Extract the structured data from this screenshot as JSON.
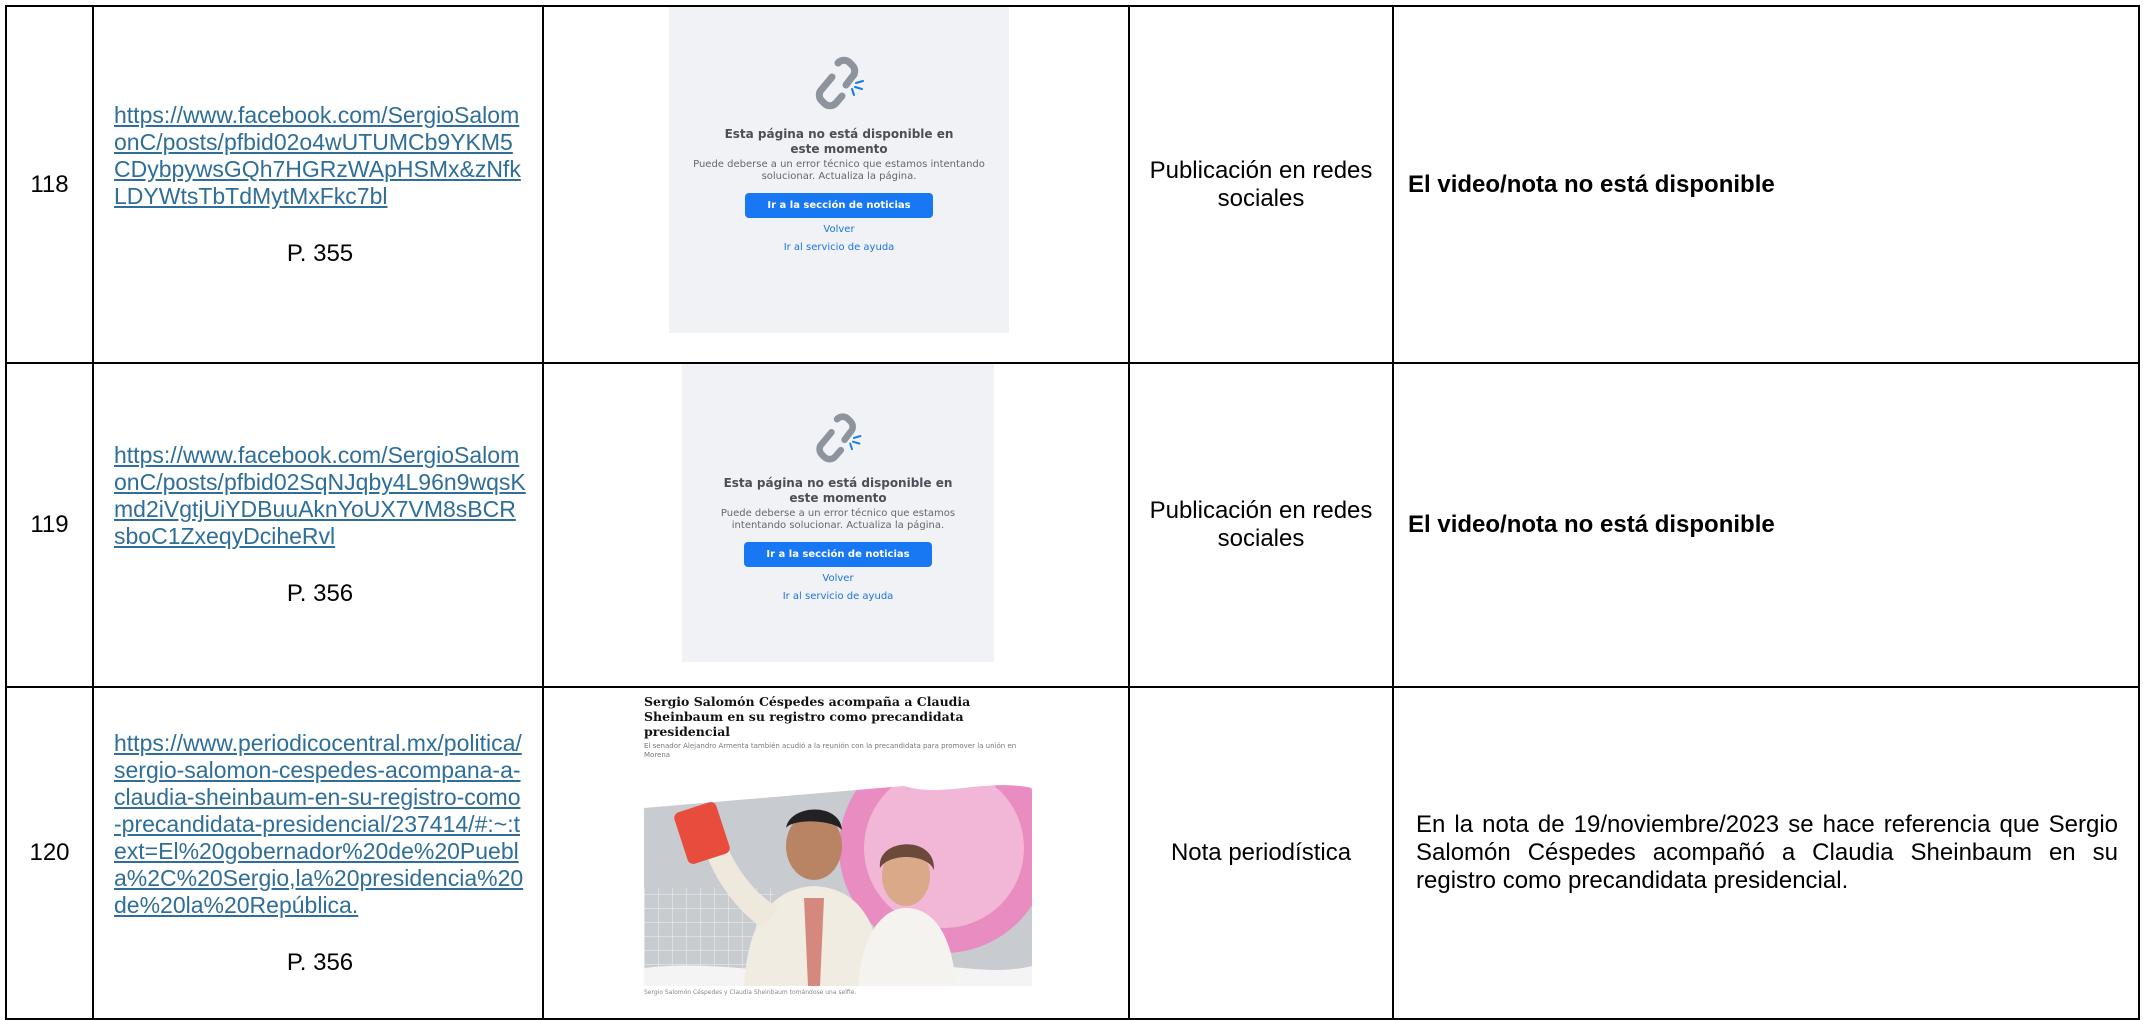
{
  "rows": [
    {
      "number": "118",
      "url": "https://www.facebook.com/SergioSalomonC/posts/pfbid02o4wUTUMCb9YKM5CDybpywsGQh7HGRzWApHSMx&zNfkLDYWtsTbTdMytMxFkc7bl",
      "page": "P. 355",
      "screenshot": {
        "title": "Esta página no está disponible en este momento",
        "description": "Puede deberse a un error técnico que estamos intentando solucionar. Actualiza la página.",
        "button": "Ir a la sección de noticias",
        "link_back": "Volver",
        "link_help": "Ir al servicio de ayuda"
      },
      "type": "Publicación en redes sociales",
      "observation": "El video/nota no está disponible"
    },
    {
      "number": "119",
      "url": "https://www.facebook.com/SergioSalomonC/posts/pfbid02SqNJqby4L96n9wqsKmd2iVgtjUiYDBuuAknYoUX7VM8sBCRsboC1ZxeqyDciheRvl",
      "page": "P. 356",
      "screenshot": {
        "title": "Esta página no está disponible en este momento",
        "description": "Puede deberse a un error técnico que estamos intentando solucionar. Actualiza la página.",
        "button": "Ir a la sección de noticias",
        "link_back": "Volver",
        "link_help": "Ir al servicio de ayuda"
      },
      "type": "Publicación en redes sociales",
      "observation": "El video/nota no está disponible"
    },
    {
      "number": "120",
      "url": "https://www.periodicocentral.mx/politica/sergio-salomon-cespedes-acompana-a-claudia-sheinbaum-en-su-registro-como-precandidata-presidencial/237414/#:~:text=El%20gobernador%20de%20Puebla%2C%20Sergio,la%20presidencia%20de%20la%20República.",
      "page": "P. 356",
      "screenshot": {
        "headline": "Sergio Salomón Céspedes acompaña a Claudia Sheinbaum en su registro como precandidata presidencial",
        "subheadline": "El senador Alejandro Armenta también acudió a la reunión con la precandidata para promover la unión en Morena",
        "caption": "Sergio Salomón Céspedes y Claudia Sheinbaum tomándose una selfie."
      },
      "type": "Nota periodística",
      "observation": "En la nota de 19/noviembre/2023 se hace referencia que Sergio Salomón Céspedes acompañó a Claudia Sheinbaum en su registro como precandidata presidencial."
    }
  ],
  "colors": {
    "link": "#2e6e99",
    "facebook_blue": "#1877f2",
    "facebook_bg": "#f0f2f5"
  },
  "icons": [
    "broken-link-icon"
  ]
}
